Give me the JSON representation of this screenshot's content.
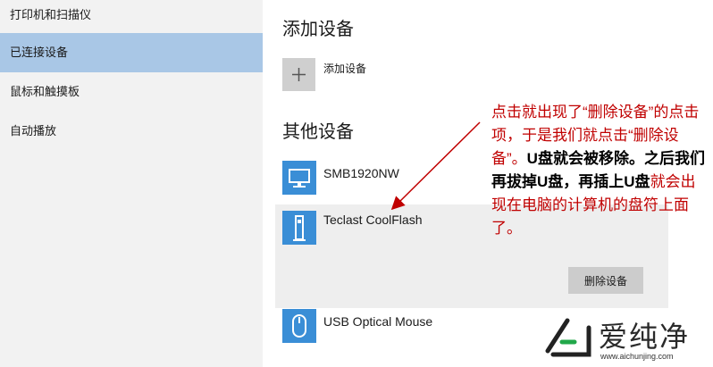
{
  "sidebar": {
    "items": [
      {
        "label": "打印机和扫描仪"
      },
      {
        "label": "已连接设备"
      },
      {
        "label": "鼠标和触摸板"
      },
      {
        "label": "自动播放"
      }
    ]
  },
  "main": {
    "add_heading": "添加设备",
    "add_label": "添加设备",
    "other_heading": "其他设备",
    "devices": [
      {
        "name": "SMB1920NW",
        "icon": "monitor-icon"
      },
      {
        "name": "Teclast CoolFlash",
        "icon": "usb-drive-icon",
        "button": "删除设备"
      },
      {
        "name": "USB Optical Mouse",
        "icon": "mouse-icon"
      }
    ]
  },
  "annotation": {
    "p1": "点击就出现了“删除设备”的点击项，于是我们就点击“删除设备”。",
    "p2": "U盘就会被移除。之后我们再拔掉U盘，再插上U盘",
    "p3": "就会出现在电脑的计算机的盘符上面了。"
  },
  "watermark": {
    "text": "爱纯净",
    "url": "www.aichunjing.com"
  },
  "colors": {
    "selected": "#a9c7e6",
    "sidebar_bg": "#f2f2f2",
    "icon_blue": "#3a8ed6",
    "annotation_red": "#c00000"
  }
}
